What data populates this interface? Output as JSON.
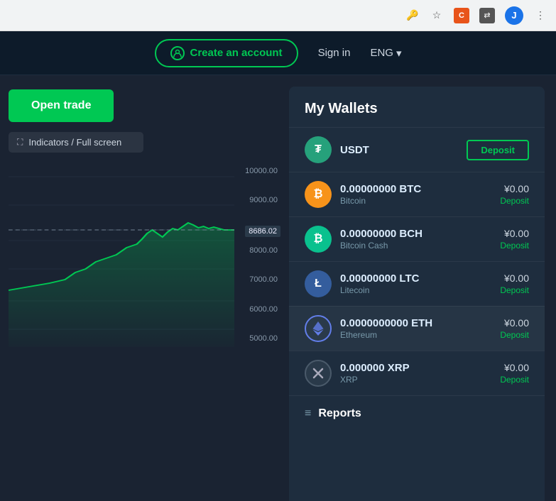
{
  "browser": {
    "avatar_label": "J",
    "ext1_label": "C",
    "ext2_label": "↔"
  },
  "nav": {
    "create_account_label": "Create an account",
    "sign_in_label": "Sign in",
    "language_label": "ENG",
    "chevron": "▾"
  },
  "chart": {
    "open_trade_label": "Open trade",
    "indicators_label": "Indicators / Full screen",
    "price_labels": [
      "10000.00",
      "9000.00",
      "8686.02",
      "8000.00",
      "7000.00",
      "6000.00",
      "5000.00"
    ],
    "current_price": "8686.02"
  },
  "wallets": {
    "title": "My Wallets",
    "items": [
      {
        "id": "usdt",
        "symbol": "USDT",
        "name": "",
        "icon_text": "₮",
        "color_class": "usdt",
        "balance": "",
        "deposit_label": "Deposit",
        "show_button": true
      },
      {
        "id": "btc",
        "symbol": "0.00000000 BTC",
        "name": "Bitcoin",
        "icon_text": "₿",
        "color_class": "btc",
        "balance": "¥0.00",
        "deposit_label": "Deposit",
        "show_button": false
      },
      {
        "id": "bch",
        "symbol": "0.00000000 BCH",
        "name": "Bitcoin Cash",
        "icon_text": "₿",
        "color_class": "bch",
        "balance": "¥0.00",
        "deposit_label": "Deposit",
        "show_button": false
      },
      {
        "id": "ltc",
        "symbol": "0.00000000 LTC",
        "name": "Litecoin",
        "icon_text": "Ł",
        "color_class": "ltc",
        "balance": "¥0.00",
        "deposit_label": "Deposit",
        "show_button": false
      },
      {
        "id": "eth",
        "symbol": "0.0000000000 ETH",
        "name": "Ethereum",
        "icon_text": "Ξ",
        "color_class": "eth",
        "balance": "¥0.00",
        "deposit_label": "Deposit",
        "show_button": false
      },
      {
        "id": "xrp",
        "symbol": "0.000000 XRP",
        "name": "XRP",
        "icon_text": "✕",
        "color_class": "xrp",
        "balance": "¥0.00",
        "deposit_label": "Deposit",
        "show_button": false
      }
    ]
  },
  "reports": {
    "label": "Reports",
    "icon": "≡"
  }
}
